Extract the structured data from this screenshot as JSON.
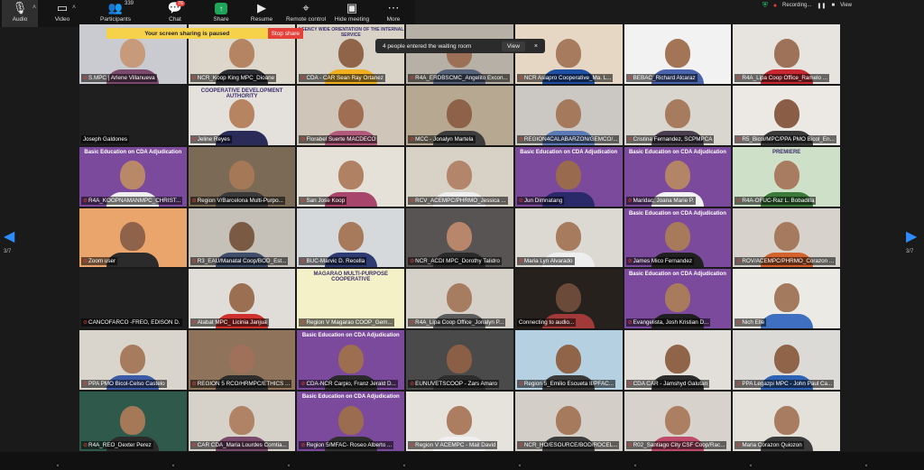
{
  "toolbar": {
    "audio_label": "Audio",
    "video_label": "Video",
    "participants_label": "Participants",
    "participants_count": "339",
    "chat_label": "Chat",
    "chat_badge": "76",
    "share_label": "Share",
    "resume_label": "Resume",
    "remote_label": "Remote control",
    "hide_meeting_label": "Hide meeting",
    "more_label": "More"
  },
  "top_right": {
    "recording_label": "Recording...",
    "view_label": "View"
  },
  "share_banner": {
    "message": "Your screen sharing is paused",
    "stop_label": "Stop share"
  },
  "waiting_room": {
    "message": "4 people entered the waiting room",
    "view_label": "View",
    "close_glyph": "×"
  },
  "pagination": {
    "left": "3/7",
    "right": "3/7"
  },
  "tiles": [
    {
      "name": "S.MPC | Arlene Villanueva",
      "muted": true,
      "bg": "#c9cbd1",
      "face": "#c79a7c",
      "body": "#7a4a6d"
    },
    {
      "name": "NCR_Koop King MPC_Dioane",
      "muted": true,
      "bg": "#dcd6cb",
      "face": "#b58462",
      "body": "#2d2d34"
    },
    {
      "name": "CDA - CAR Sean Ray Ortanez",
      "muted": true,
      "bg": "#d8d2c7",
      "face": "#8f6448",
      "body": "#f0b020",
      "overlay": "AGENCY WIDE ORIENTATION OF THE INTERNAL SERVICE"
    },
    {
      "name": "R4A_ERDBSCMC_Angelito Excon...",
      "muted": true,
      "bg": "#b7b0a7",
      "face": "#9b7056",
      "body": "#56627a"
    },
    {
      "name": "NCR Asiapro Cooperative_Ma. L...",
      "muted": true,
      "bg": "#e5d7c3",
      "face": "#a77b5e",
      "body": "#1f4fa3"
    },
    {
      "name": "BEBAC_Richard Alcaraz",
      "muted": true,
      "bg": "#f2f2f2",
      "face": "#a47456",
      "body": "#4a63ad"
    },
    {
      "name": "R4A_Lipa Coop Office_Ramelo ...",
      "muted": true,
      "bg": "#e7e4df",
      "face": "#9d7258",
      "body": "#c72832"
    },
    {
      "name": "Joseph Galdones",
      "muted": false,
      "bg": "#1f1f1f",
      "face": "",
      "body": ""
    },
    {
      "name": "Jeline Reyes",
      "muted": true,
      "bg": "#e4e1dc",
      "face": "#b78462",
      "body": "#2b2b5a",
      "overlay": "COOPERATIVE DEVELOPMENT AUTHORITY"
    },
    {
      "name": "Florabel Suerte MACDECO",
      "muted": true,
      "bg": "#cfc5b8",
      "face": "#9f6e53",
      "body": "#b35a7c"
    },
    {
      "name": "MCC - Jonalyn Martela",
      "muted": true,
      "bg": "#b6a891",
      "face": "#8d6249",
      "body": "#3c3c3c"
    },
    {
      "name": "REGION4CALABARZON/GEMCO/...",
      "muted": true,
      "bg": "#cbc8c4",
      "face": "#a57a5c",
      "body": "#5a79b5"
    },
    {
      "name": "Cristina Fernandez, SCPMPCA",
      "muted": true,
      "bg": "#d9d5cf",
      "face": "#a77b5e",
      "body": "#4a3f4f"
    },
    {
      "name": "R5_Bicol/MPC/PPA PMO Bicol_En...",
      "muted": true,
      "bg": "#ece9e4",
      "face": "#8a5e46",
      "body": "#3a3a3a"
    },
    {
      "name": "R4A_KOOPNAMANMPC_CHRIST...",
      "muted": true,
      "bg": "#7b4a9c",
      "face": "#b98868",
      "body": "#eeeeee",
      "overlay": "Basic Education on CDA Adjudication"
    },
    {
      "name": "Region V/Barcelona Multi-Purpo...",
      "muted": true,
      "bg": "#7b6a55",
      "face": "#a57858",
      "body": "#3a3a3a"
    },
    {
      "name": "San Jose Koop",
      "muted": true,
      "bg": "#e5e0d8",
      "face": "#b08162",
      "body": "#a7466a"
    },
    {
      "name": "RCV_ACEMPC/PHRMO_Jessica ...",
      "muted": true,
      "bg": "#d8d1c6",
      "face": "#b3856a",
      "body": "#eeeeee"
    },
    {
      "name": "Jun Dimnatang",
      "muted": true,
      "bg": "#7b4a9c",
      "face": "#9a6a4e",
      "body": "#2a2a6b",
      "overlay": "Basic Education on CDA Adjudication"
    },
    {
      "name": "Maridac, Joana Marie P.",
      "muted": true,
      "bg": "#7b4a9c",
      "face": "#b38465",
      "body": "#f2f2f2",
      "overlay": "Basic Education on CDA Adjudication"
    },
    {
      "name": "R4A-OFUC-Raz L. Bobadilla",
      "muted": true,
      "bg": "#cfe0c9",
      "face": "#a87c60",
      "body": "#3b7a3a",
      "overlay": "PREMIERE"
    },
    {
      "name": "Zoom user",
      "muted": true,
      "bg": "#e9a56b",
      "face": "#8f6349",
      "body": "#2b2b2b"
    },
    {
      "name": "R3_EAU/Manatal Coop/BOD_Est...",
      "muted": true,
      "bg": "#c5c0b8",
      "face": "#7b5a44",
      "body": "#3f4f6b"
    },
    {
      "name": "BUC-Marvic D. Recella",
      "muted": true,
      "bg": "#d5d9dc",
      "face": "#a67a5b",
      "body": "#2d3b72"
    },
    {
      "name": "NCR_ACDI MPC_Dorothy Talidro",
      "muted": true,
      "bg": "#595454",
      "face": "#b8866a",
      "body": "#2a2a2a"
    },
    {
      "name": "Maria Lyn Alvarado",
      "muted": true,
      "bg": "#dcd8d2",
      "face": "#a77b5e",
      "body": "#eeeeee"
    },
    {
      "name": "James Mico Fernandez",
      "muted": true,
      "bg": "#7b4a9c",
      "face": "#a87a5c",
      "body": "#202020",
      "overlay": "Basic Education on CDA Adjudication"
    },
    {
      "name": "ROV/ACEMPC/PHRMO_Corazon ...",
      "muted": true,
      "bg": "#d7d2cb",
      "face": "#a57a5e",
      "body": "#d4622c"
    },
    {
      "name": "CANCOFARCO -FREO, EDISON D.",
      "muted": true,
      "bg": "#1f1f1f",
      "face": "",
      "body": ""
    },
    {
      "name": "Alabat MPC_ Licinia Janjua",
      "muted": true,
      "bg": "#e0ddd8",
      "face": "#9b6f51",
      "body": "#d0312d"
    },
    {
      "name": "Region V Magarao COOP_Gem...",
      "muted": true,
      "bg": "#f4f1c9",
      "face": "",
      "body": "",
      "overlay": "MAGARAO MULTI-PURPOSE COOPERATIVE"
    },
    {
      "name": "R4A_Lipa Coop Office_Jonalyn P...",
      "muted": true,
      "bg": "#d5d0c8",
      "face": "#a77d61",
      "body": "#5b5b5b"
    },
    {
      "name": "Connecting to audio...",
      "muted": false,
      "bg": "#26211d",
      "face": "#6b4a39",
      "body": "#a33a3a"
    },
    {
      "name": "Evangelista, Josh Kristian D...",
      "muted": true,
      "bg": "#7b4a9c",
      "face": "#a87b5d",
      "body": "#1f1f1f",
      "overlay": "Basic Education on CDA Adjudication"
    },
    {
      "name": "Nich Elle",
      "muted": true,
      "bg": "#eceae5",
      "face": "#a37a5d",
      "body": "#3f6fc0"
    },
    {
      "name": "PPA PMO Bicol-Celso Castelo",
      "muted": true,
      "bg": "#d9d4cc",
      "face": "#a77b5e",
      "body": "#3c5aa6"
    },
    {
      "name": "REGION 5 RCO/HRMPC/ETHICS ...",
      "muted": true,
      "bg": "#8f735a",
      "face": "#a0715a",
      "body": "#2d2d2d"
    },
    {
      "name": "CDA-NCR Carpio, Franz Jerald D...",
      "muted": true,
      "bg": "#7b4a9c",
      "face": "#9e6e50",
      "body": "#2a2a2a",
      "overlay": "Basic Education on CDA Adjudication"
    },
    {
      "name": "EUNUVETSCOOP - Zars Amaro",
      "muted": true,
      "bg": "#4a4a4a",
      "face": "#8b5f45",
      "body": "#2d2d2d"
    },
    {
      "name": "Region 5_Emilio Escueta II/PFAC...",
      "muted": true,
      "bg": "#b5d0e0",
      "face": "#8f6448",
      "body": "#3a3a3a"
    },
    {
      "name": "CDA CAR - Jamshyd Galutan",
      "muted": true,
      "bg": "#e2dfda",
      "face": "#8f6448",
      "body": "#2b2b2b"
    },
    {
      "name": "PPA Legazpi MPC - John Paul Ca...",
      "muted": true,
      "bg": "#dcdad6",
      "face": "#8f6448",
      "body": "#2d62b4"
    },
    {
      "name": "R4A_REO_Dexter Perez",
      "muted": true,
      "bg": "#2f5a4b",
      "face": "#a57858",
      "body": "#2a2a2a"
    },
    {
      "name": "CAR CDA_Maria Lourdes Comtia...",
      "muted": true,
      "bg": "#d6d1c9",
      "face": "#b08366",
      "body": "#7a4a6d"
    },
    {
      "name": "Region 5/MFAC- Roseo Alberto ...",
      "muted": true,
      "bg": "#7b4a9c",
      "face": "#9b6c4f",
      "body": "#2d2d2d",
      "overlay": "Basic Education on CDA Adjudication"
    },
    {
      "name": "Region V ACEMPC - Mail David",
      "muted": true,
      "bg": "#e6e2dc",
      "face": "#ac7d60",
      "body": "#f0f0f0"
    },
    {
      "name": "NCR_HO/ESOURCE/BOD/ROCEL...",
      "muted": true,
      "bg": "#d3cec7",
      "face": "#a57a5d",
      "body": "#3c3c3c"
    },
    {
      "name": "R02_Santiago City CSF Coop/Rac...",
      "muted": true,
      "bg": "#d7d2cb",
      "face": "#ad7f62",
      "body": "#c04a6a"
    },
    {
      "name": "Maria Corazon Quiozon",
      "muted": true,
      "bg": "#e4e0da",
      "face": "#a87c60",
      "body": "#3a3a3a"
    }
  ]
}
